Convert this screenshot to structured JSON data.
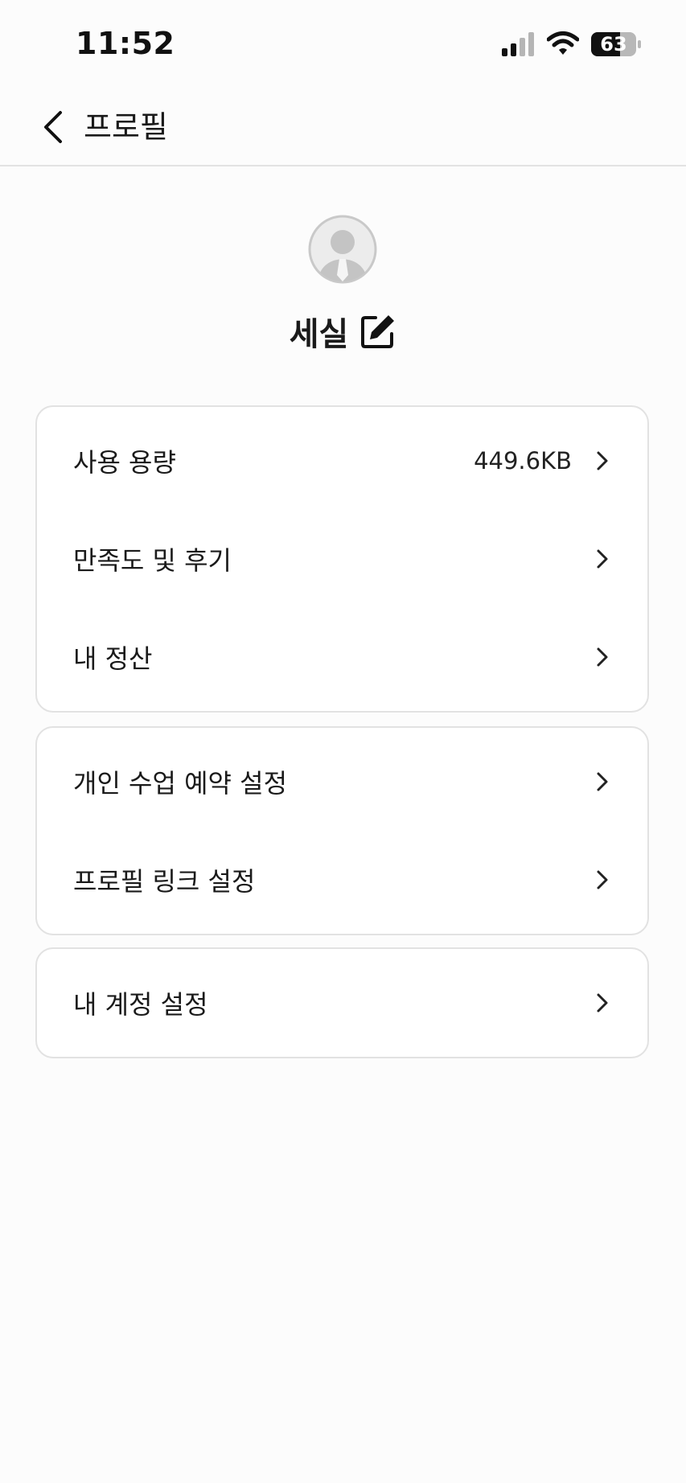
{
  "status_bar": {
    "time": "11:52",
    "battery_level": "63",
    "icons": [
      "signal-icon",
      "wifi-icon",
      "battery-icon"
    ]
  },
  "nav": {
    "title": "프로필",
    "back_icon": "chevron-left-icon"
  },
  "profile": {
    "name": "세실",
    "avatar_icon": "avatar-placeholder-icon",
    "edit_icon": "edit-icon"
  },
  "sections": [
    {
      "items": [
        {
          "label": "사용 용량",
          "value": "449.6KB"
        },
        {
          "label": "만족도 및 후기",
          "value": ""
        },
        {
          "label": "내 정산",
          "value": ""
        }
      ]
    },
    {
      "items": [
        {
          "label": "개인 수업 예약 설정",
          "value": ""
        },
        {
          "label": "프로필 링크 설정",
          "value": ""
        }
      ]
    },
    {
      "items": [
        {
          "label": "내 계정 설정",
          "value": ""
        }
      ]
    }
  ],
  "colors": {
    "background": "#fcfcfc",
    "card": "#ffffff",
    "border": "#e2e2e2",
    "text": "#1a1a1a",
    "avatar": "#c8c8c8"
  }
}
